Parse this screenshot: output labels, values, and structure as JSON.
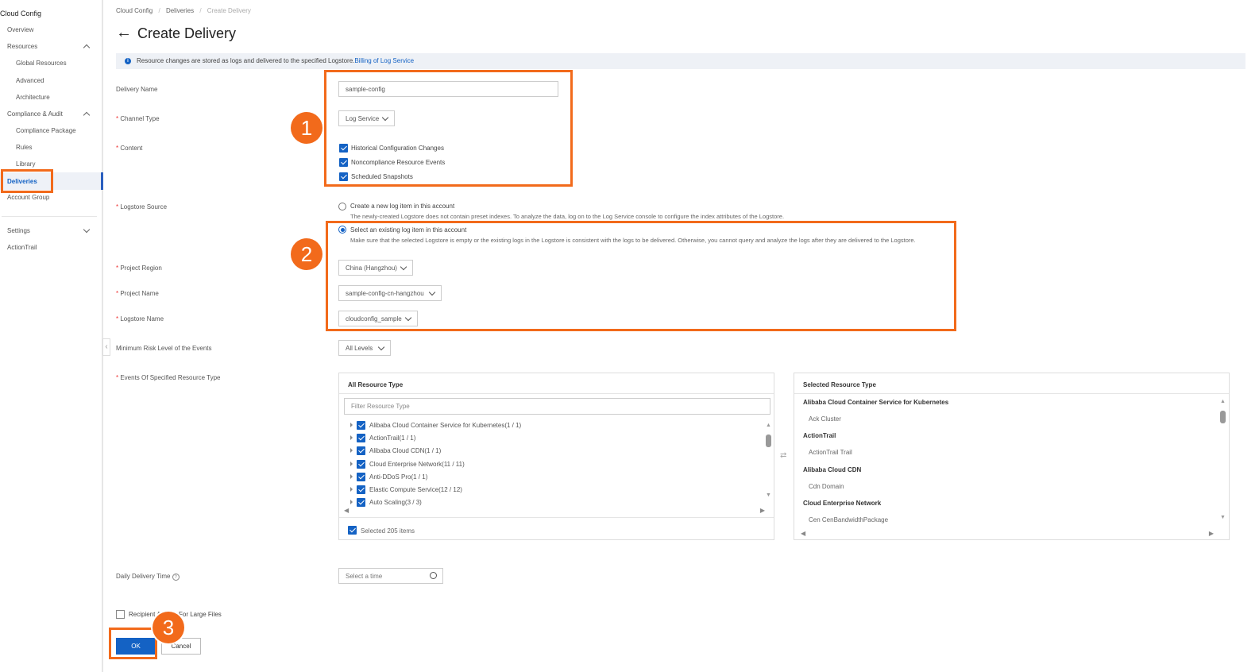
{
  "sidebar": {
    "title": "Cloud Config",
    "items": {
      "overview": "Overview",
      "resources": "Resources",
      "global_resources": "Global Resources",
      "advanced": "Advanced",
      "architecture": "Architecture",
      "compliance_audit": "Compliance & Audit",
      "compliance_package": "Compliance Package",
      "rules": "Rules",
      "library": "Library",
      "deliveries": "Deliveries",
      "account_group": "Account Group",
      "settings": "Settings",
      "actiontrail": "ActionTrail"
    }
  },
  "breadcrumb": [
    "Cloud Config",
    "Deliveries",
    "Create Delivery"
  ],
  "page_title": "Create Delivery",
  "info": {
    "text": "Resource changes are stored as logs and delivered to the specified Logstore.",
    "link": "Billing of Log Service"
  },
  "form": {
    "delivery_name": {
      "label": "Delivery Name",
      "value": "sample-config"
    },
    "channel_type": {
      "label": "Channel Type",
      "value": "Log Service"
    },
    "content": {
      "label": "Content",
      "options": [
        "Historical Configuration Changes",
        "Noncompliance Resource Events",
        "Scheduled Snapshots"
      ]
    },
    "logstore_source": {
      "label": "Logstore Source",
      "new_option": "Create a new log item in this account",
      "new_hint": "The newly-created Logstore does not contain preset indexes. To analyze the data, log on to the Log Service console to configure the index attributes of the Logstore.",
      "existing_option": "Select an existing log item in this account",
      "existing_hint": "Make sure that the selected Logstore is empty or the existing logs in the Logstore is consistent with the logs to be delivered. Otherwise, you cannot query and analyze the logs after they are delivered to the Logstore."
    },
    "project_region": {
      "label": "Project Region",
      "value": "China (Hangzhou)"
    },
    "project_name": {
      "label": "Project Name",
      "value": "sample-config-cn-hangzhou"
    },
    "logstore_name": {
      "label": "Logstore Name",
      "value": "cloudconfig_sample"
    },
    "risk_level": {
      "label": "Minimum Risk Level of the Events",
      "value": "All Levels"
    },
    "events": {
      "label": "Events Of Specified Resource Type"
    },
    "daily_time": {
      "label": "Daily Delivery Time",
      "placeholder": "Select a time"
    },
    "recipient": {
      "label_a": "Recipient A",
      "label_b": "For Large Files"
    }
  },
  "all_types": {
    "title": "All Resource Type",
    "filter_placeholder": "Filter Resource Type",
    "items": [
      "Alibaba Cloud Container Service for Kubernetes(1 / 1)",
      "ActionTrail(1 / 1)",
      "Alibaba Cloud CDN(1 / 1)",
      "Cloud Enterprise Network(11 / 11)",
      "Anti-DDoS Pro(1 / 1)",
      "Elastic Compute Service(12 / 12)",
      "Auto Scaling(3 / 3)"
    ],
    "footer": "Selected 205 items"
  },
  "selected_types": {
    "title": "Selected Resource Type",
    "groups": [
      {
        "name": "Alibaba Cloud Container Service for Kubernetes",
        "item": "Ack Cluster"
      },
      {
        "name": "ActionTrail",
        "item": "ActionTrail Trail"
      },
      {
        "name": "Alibaba Cloud CDN",
        "item": "Cdn Domain"
      },
      {
        "name": "Cloud Enterprise Network",
        "item": "Cen CenBandwidthPackage"
      }
    ]
  },
  "buttons": {
    "ok": "OK",
    "cancel": "Cancel"
  },
  "badges": [
    "1",
    "2",
    "3"
  ],
  "colors": {
    "accent": "#1462c4",
    "highlight": "#f26a1b"
  }
}
